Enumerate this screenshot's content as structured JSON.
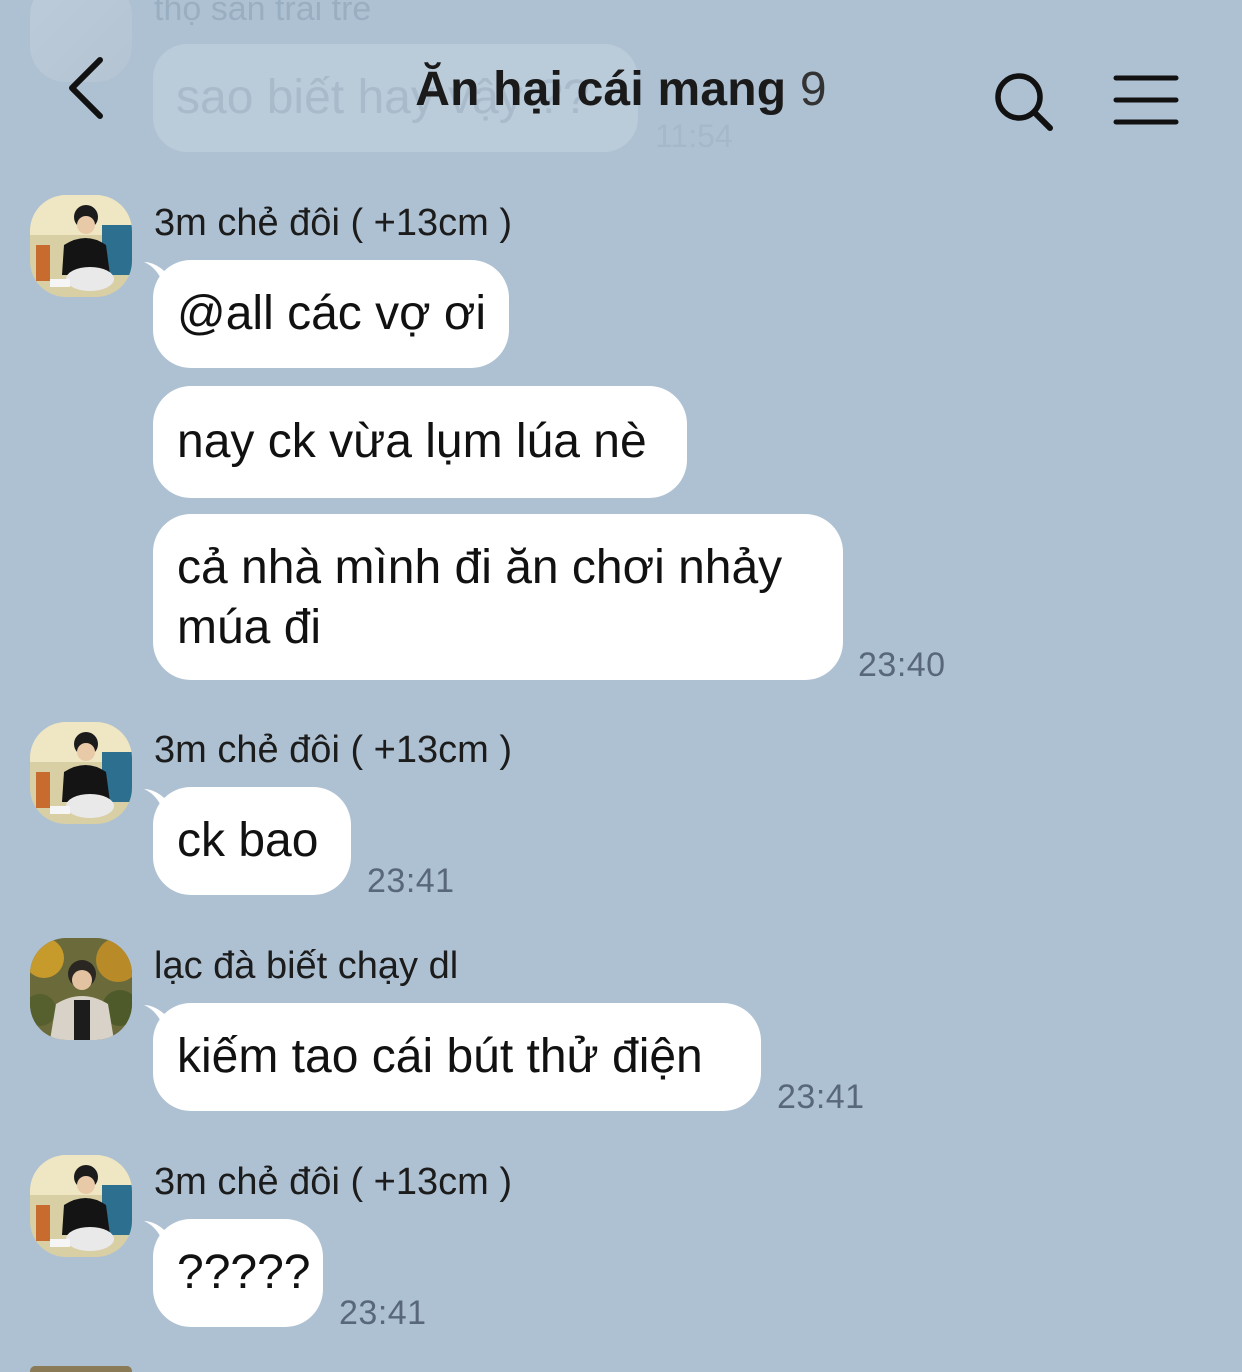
{
  "header": {
    "title": "Ăn hại cái mang",
    "member_count": "9"
  },
  "previous_message": {
    "sender": "thọ săn trái tre",
    "text": "sao biết hay vậy ??",
    "time": "11:54"
  },
  "messages": [
    {
      "sender": "3m chẻ đôi ( +13cm )",
      "bubbles": [
        "@all các vợ ơi",
        "nay ck vừa lụm lúa nè",
        "cả nhà mình đi ăn chơi nhảy múa đi"
      ],
      "time": "23:40"
    },
    {
      "sender": "3m chẻ đôi ( +13cm )",
      "bubbles": [
        "ck bao"
      ],
      "time": "23:41"
    },
    {
      "sender": "lạc đà biết chạy dl",
      "bubbles": [
        "kiếm tao cái bút thử điện"
      ],
      "time": "23:41"
    },
    {
      "sender": "3m chẻ đôi ( +13cm )",
      "bubbles": [
        "?????"
      ],
      "time": "23:41"
    }
  ],
  "colors": {
    "background": "#aec1d3",
    "bubble": "#ffffff",
    "timestamp": "#58677a"
  },
  "icons": {
    "back": "chevron-left-icon",
    "search": "search-icon",
    "menu": "hamburger-menu-icon"
  }
}
